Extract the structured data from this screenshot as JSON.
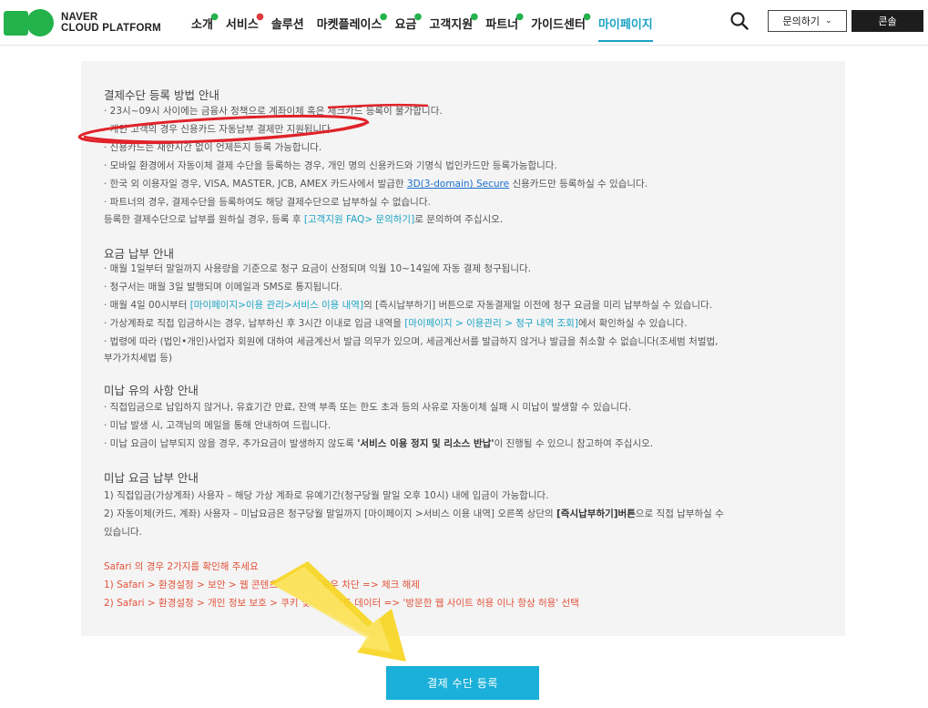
{
  "header": {
    "logo_line1": "NAVER",
    "logo_line2": "CLOUD PLATFORM",
    "nav": [
      {
        "label": "소개",
        "dot": "green"
      },
      {
        "label": "서비스",
        "dot": "red"
      },
      {
        "label": "솔루션",
        "dot": ""
      },
      {
        "label": "마켓플레이스",
        "dot": "green"
      },
      {
        "label": "요금",
        "dot": "green"
      },
      {
        "label": "고객지원",
        "dot": "green"
      },
      {
        "label": "파트너",
        "dot": "green"
      },
      {
        "label": "가이드센터",
        "dot": "green"
      },
      {
        "label": "마이페이지",
        "dot": "",
        "active": true
      }
    ],
    "inquiry_label": "문의하기",
    "console_label": "콘솔"
  },
  "sections": {
    "payment_method": {
      "title": "결제수단 등록 방법 안내",
      "lines": [
        "· 23시~09시 사이에는 금융사 정책으로 계좌이체 혹은 체크카드 등록이 불가합니다.",
        "· 개인 고객의 경우 신용카드 자동납부 결제만 지원됩니다.",
        "· 신용카드는 재한시간 없이 언제든지 등록 가능합니다.",
        "· 모바일 환경에서 자동이체 결제 수단을 등록하는 경우, 개인 명의 신용카드와 기명식 법인카드만 등록가능합니다.",
        "· 파트너의 경우, 결제수단을 등록하여도 해당 결제수단으로 납부하실 수 없습니다."
      ],
      "line4_prefix": "· 한국 외 이용자일 경우, VISA, MASTER, JCB, AMEX 카드사에서 발급한 ",
      "line4_link": "3D(3-domain) Secure",
      "line4_suffix": " 신용카드만 등록하실 수 있습니다.",
      "footer_prefix": "등록한 결제수단으로 납부를 원하실 경우, 등록 후 ",
      "footer_link": "[고객지원 FAQ> 문의하기]",
      "footer_suffix": "로 문의하여 주십시오."
    },
    "billing": {
      "title": "요금 납부 안내",
      "line1": "· 매월 1일부터 말일까지 사용량을 기준으로 청구 요금이 산정되며 익월 10~14일에 자동 결제 청구됩니다.",
      "line2": "· 청구서는 매월 3일 발행되며 이메일과 SMS로 통지됩니다.",
      "line3_prefix": "· 매월 4일 00시부터 ",
      "line3_link": "[마이페이지>이용 관리>서비스 이용 내역]",
      "line3_suffix": "의 [즉시납부하기] 버튼으로 자동결제일 이전에 청구 요금을 미리 납부하실 수 있습니다.",
      "line4_prefix": "· 가상계좌로 직접 입금하시는 경우, 납부하신 후 3시간 이내로 입금 내역을 ",
      "line4_link": "[마이페이지 > 이용관리 > 청구 내역 조회]",
      "line4_suffix": "에서 확인하실 수 있습니다.",
      "line5": "· 법령에 따라 (법인•개인)사업자 회원에 대하여 세금계산서 발급 의무가 있으며, 세금계산서를 발급하지 않거나 발급을 취소할 수 없습니다(조세범 처벌법,",
      "line6": "부가가치세법 등)"
    },
    "overdue_notes": {
      "title": "미납 유의 사항 안내",
      "line1": "· 직접입금으로 납입하지 않거나, 유효기간 만료, 잔액 부족 또는 한도 초과 등의 사유로 자동이체 실패 시 미납이 발생할 수 있습니다.",
      "line2": "· 미납 발생 시, 고객님의 메일을 통해 안내하여 드립니다.",
      "line3_prefix": "· 미납 요금이 납부되지 않을 경우, 추가요금이 발생하지 않도록 ",
      "line3_bold": "'서비스 이용 정지 및 리소스 반납'",
      "line3_suffix": "이 진행될 수 있으니 참고하여 주십시오."
    },
    "overdue_payment": {
      "title": "미납 요금 납부 안내",
      "line1": "1) 직접입금(가상계좌) 사용자 – 해당 가상 계좌로 유예기간(청구당월 말일 오후 10시) 내에 입금이 가능합니다.",
      "line2_prefix": "2) 자동이체(카드, 계좌) 사용자 – 미납요금은 청구당월 말일까지 [마이페이지 >서비스 이용 내역] 오른쪽 상단의 ",
      "line2_bold": "[즉시납부하기]버튼",
      "line2_suffix": "으로 직접 납부하실 수",
      "line3": "있습니다."
    },
    "safari": {
      "title": "Safari 의 경우 2가지를 확인해 주세요",
      "line1": "1) Safari > 환경설정 > 보안 > 웹 콘텐츠 > 팝업 윈도우 차단 => 체크 해제",
      "line2": "2) Safari > 환경설정 > 개인 정보 보호 > 쿠키 및 웹 사이트 데이터 => '방문한 웹 사이트 허용 이나 항상 허용' 선택"
    }
  },
  "register_button": "결제 수단 등록",
  "colors": {
    "brand_green": "#23b24b",
    "accent": "#1ba3c4",
    "button": "#1bb0d9",
    "annotation_red": "#e0222a",
    "arrow_yellow": "#f7d51d"
  }
}
